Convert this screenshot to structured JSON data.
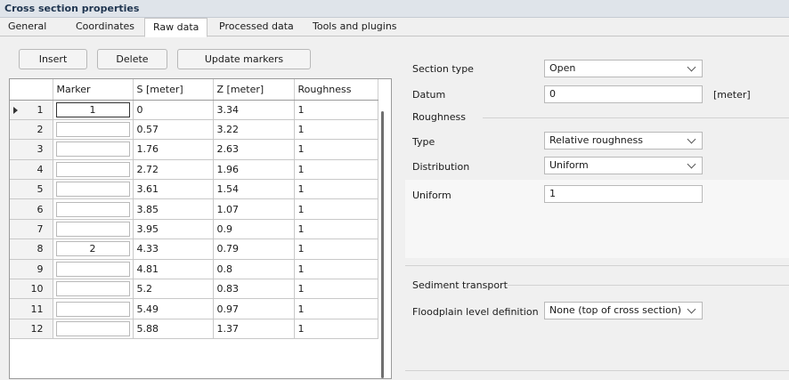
{
  "window": {
    "title": "Cross section properties"
  },
  "tabs": [
    "General",
    "Coordinates",
    "Raw data",
    "Processed data",
    "Tools and plugins"
  ],
  "active_tab": "Raw data",
  "toolbar": {
    "insert_label": "Insert",
    "delete_label": "Delete",
    "update_markers_label": "Update markers"
  },
  "grid": {
    "columns": [
      "",
      "Marker",
      "S [meter]",
      "Z [meter]",
      "Roughness"
    ],
    "rows": [
      {
        "n": "1",
        "marker": "1",
        "s": "0",
        "z": "3.34",
        "r": "1"
      },
      {
        "n": "2",
        "marker": "",
        "s": "0.57",
        "z": "3.22",
        "r": "1"
      },
      {
        "n": "3",
        "marker": "",
        "s": "1.76",
        "z": "2.63",
        "r": "1"
      },
      {
        "n": "4",
        "marker": "",
        "s": "2.72",
        "z": "1.96",
        "r": "1"
      },
      {
        "n": "5",
        "marker": "",
        "s": "3.61",
        "z": "1.54",
        "r": "1"
      },
      {
        "n": "6",
        "marker": "",
        "s": "3.85",
        "z": "1.07",
        "r": "1"
      },
      {
        "n": "7",
        "marker": "",
        "s": "3.95",
        "z": "0.9",
        "r": "1"
      },
      {
        "n": "8",
        "marker": "2",
        "s": "4.33",
        "z": "0.79",
        "r": "1"
      },
      {
        "n": "9",
        "marker": "",
        "s": "4.81",
        "z": "0.8",
        "r": "1"
      },
      {
        "n": "10",
        "marker": "",
        "s": "5.2",
        "z": "0.83",
        "r": "1"
      },
      {
        "n": "11",
        "marker": "",
        "s": "5.49",
        "z": "0.97",
        "r": "1"
      },
      {
        "n": "12",
        "marker": "",
        "s": "5.88",
        "z": "1.37",
        "r": "1"
      }
    ]
  },
  "props": {
    "section_type": {
      "label": "Section type",
      "value": "Open"
    },
    "datum": {
      "label": "Datum",
      "value": "0",
      "unit": "[meter]"
    },
    "roughness": {
      "group": "Roughness",
      "type": {
        "label": "Type",
        "value": "Relative roughness"
      },
      "distribution": {
        "label": "Distribution",
        "value": "Uniform"
      },
      "uniform": {
        "label": "Uniform",
        "value": "1"
      }
    },
    "sediment": {
      "group": "Sediment transport",
      "floodplain": {
        "label": "Floodplain level definition",
        "value": "None (top of cross section)"
      }
    }
  }
}
